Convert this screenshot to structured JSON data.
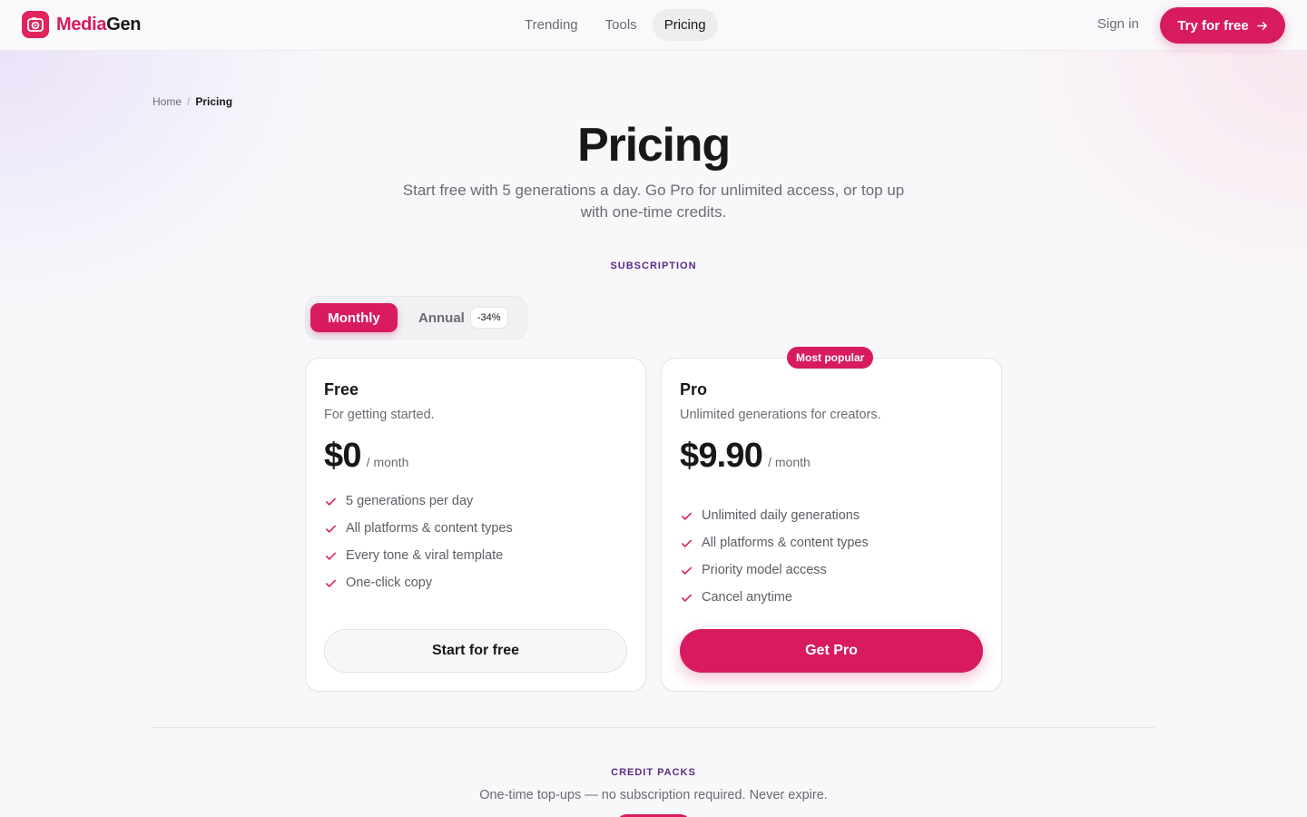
{
  "brand": {
    "name_part1": "Media",
    "name_part2": "Gen",
    "logo_icon": "camera-icon",
    "accent": "#d81b60"
  },
  "nav": {
    "items": [
      {
        "label": "Trending"
      },
      {
        "label": "Tools"
      },
      {
        "label": "Pricing",
        "active": true
      }
    ]
  },
  "header": {
    "signin_label": "Sign in",
    "cta_label": "Try for free",
    "cta_icon": "arrow-right-icon"
  },
  "breadcrumb": {
    "home": "Home",
    "separator": "/",
    "current": "Pricing"
  },
  "hero": {
    "title": "Pricing",
    "subtitle": "Start free with 5 generations a day. Go Pro for unlimited access, or top up with one-time credits."
  },
  "subscription": {
    "section_label": "SUBSCRIPTION",
    "billing_toggle": {
      "monthly": "Monthly",
      "annual": "Annual",
      "annual_discount": "-34%",
      "selected": "Monthly"
    }
  },
  "plans": [
    {
      "name": "Free",
      "description": "For getting started.",
      "price": "$0",
      "period": "/ month",
      "features": [
        "5 generations per day",
        "All platforms & content types",
        "Every tone & viral template",
        "One-click copy"
      ],
      "cta": "Start for free"
    },
    {
      "name": "Pro",
      "badge": "Most popular",
      "description": "Unlimited generations for creators.",
      "price": "$9.90",
      "period": "/ month",
      "features": [
        "Unlimited daily generations",
        "All platforms & content types",
        "Priority model access",
        "Cancel anytime"
      ],
      "cta": "Get Pro"
    }
  ],
  "credit_packs": {
    "section_label": "CREDIT PACKS",
    "description": "One-time top-ups — no subscription required. Never expire."
  }
}
